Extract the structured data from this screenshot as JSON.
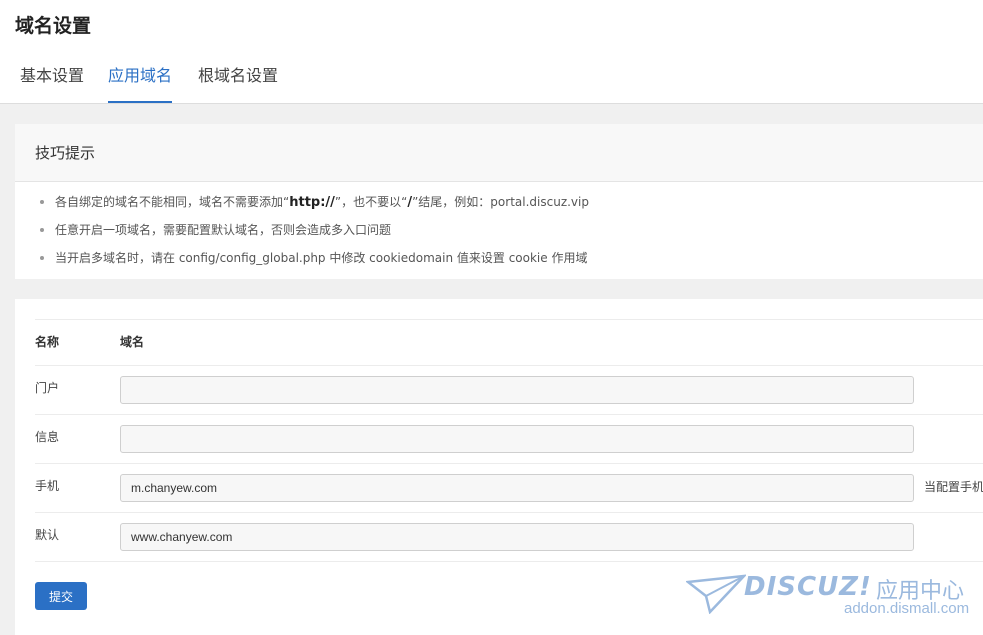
{
  "page": {
    "title": "域名设置"
  },
  "tabs": [
    {
      "label": "基本设置",
      "active": false
    },
    {
      "label": "应用域名",
      "active": true
    },
    {
      "label": "根域名设置",
      "active": false
    }
  ],
  "tips": {
    "heading": "技巧提示",
    "items": [
      {
        "before": "各自绑定的域名不能相同，域名不需要添加“",
        "bold1": "http://",
        "middle": "”，也不要以“",
        "bold2": "/",
        "after": "”结尾，例如：portal.discuz.vip"
      },
      {
        "text": "任意开启一项域名，需要配置默认域名，否则会造成多入口问题"
      },
      {
        "text": "当开启多域名时，请在 config/config_global.php 中修改 cookiedomain 值来设置 cookie 作用域"
      }
    ]
  },
  "form": {
    "col_name": "名称",
    "col_domain": "域名",
    "rows": [
      {
        "label": "门户",
        "value": ""
      },
      {
        "label": "信息",
        "value": ""
      },
      {
        "label": "手机",
        "value": "m.chanyew.com",
        "hint": "当配置手机"
      },
      {
        "label": "默认",
        "value": "www.chanyew.com"
      }
    ],
    "submit_label": "提交"
  },
  "watermark": {
    "brand": "DISCUZ!",
    "cn": "应用中心",
    "url": "addon.dismall.com",
    "color": "#9bb9de"
  },
  "colors": {
    "accent": "#2b70c5"
  }
}
